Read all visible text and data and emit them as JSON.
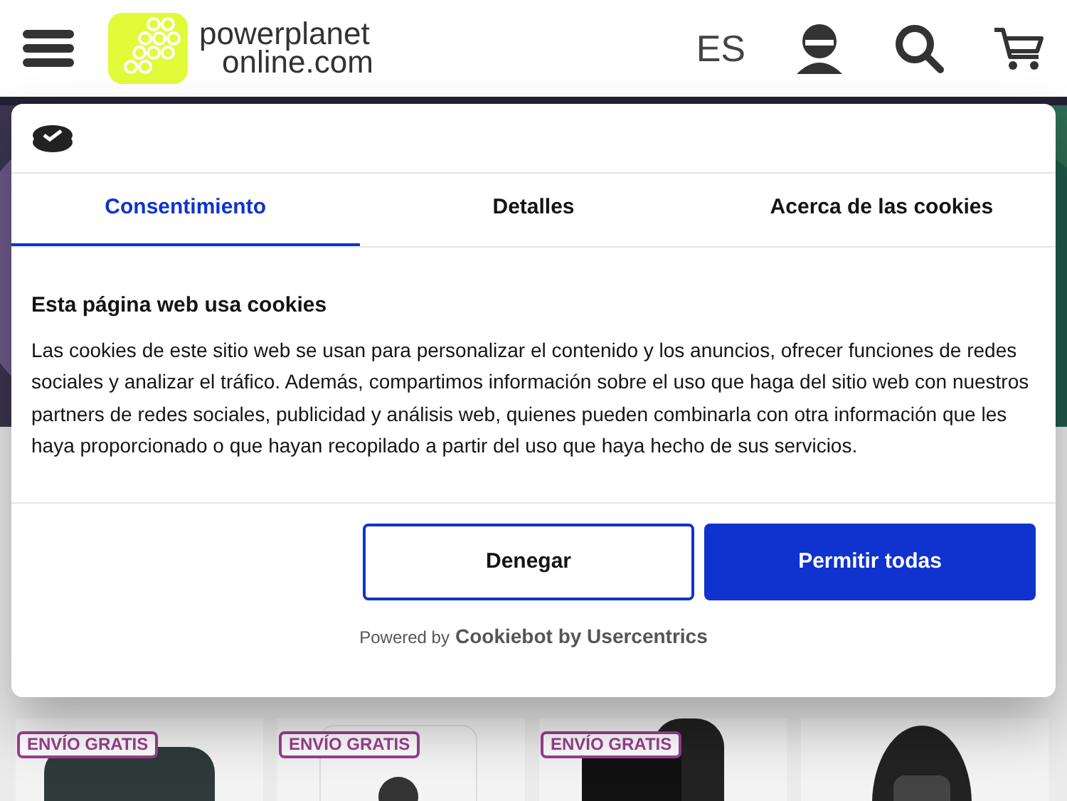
{
  "header": {
    "logo_line_1": "powerplanet",
    "logo_line_2": "online.com",
    "language": "ES"
  },
  "dialog": {
    "tabs": [
      {
        "label": "Consentimiento",
        "selected": true
      },
      {
        "label": "Detalles",
        "selected": false
      },
      {
        "label": "Acerca de las cookies",
        "selected": false
      }
    ],
    "heading": "Esta página web usa cookies",
    "body": "Las cookies de este sitio web se usan para personalizar el contenido y los anuncios, ofrecer funciones de redes sociales y analizar el tráfico. Además, compartimos información sobre el uso que haga del sitio web con nuestros partners de redes sociales, publicidad y análisis web, quienes pueden combinarla con otra información que les haya proporcionado o que hayan recopilado a partir del uso que haya hecho de sus servicios.",
    "buttons": [
      {
        "label": "Denegar",
        "kind": "outline"
      },
      {
        "label": "Permitir todas",
        "kind": "primary"
      }
    ],
    "powered_by": "Powered by",
    "brand": "Cookiebot by Usercentrics"
  },
  "products": [
    {
      "badge": "ENVÍO GRATIS",
      "kind": "picture"
    },
    {
      "badge": "ENVÍO GRATIS",
      "kind": "picture"
    },
    {
      "badge": "ENVÍO GRATIS",
      "kind": "picture"
    },
    {
      "kind": "picture"
    }
  ]
}
